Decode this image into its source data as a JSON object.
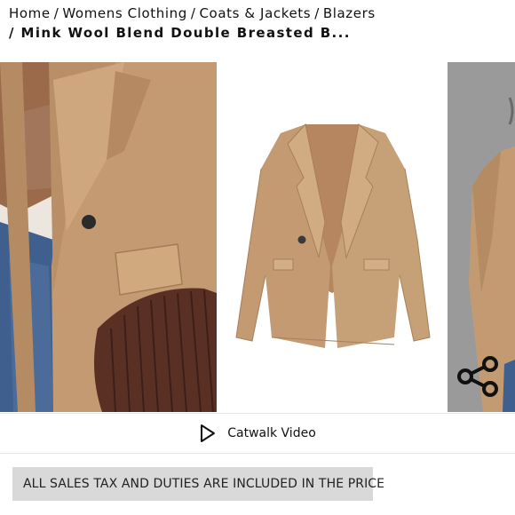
{
  "breadcrumb": {
    "items": [
      "Home",
      "Womens Clothing",
      "Coats & Jackets",
      "Blazers"
    ],
    "separator": "/",
    "current": "Mink Wool Blend Double Breasted B..."
  },
  "gallery": {
    "slides": [
      "model-closeup",
      "product-flatlay",
      "model-side"
    ]
  },
  "catwalk": {
    "label": "Catwalk Video",
    "icon": "play-icon"
  },
  "share": {
    "icon": "share-icon"
  },
  "tax_notice": {
    "text": "ALL SALES TAX AND DUTIES ARE INCLUDED IN THE PRICE"
  },
  "colors": {
    "coat": "#c39a72",
    "background": "#ffffff",
    "banner": "#d9d9d9"
  }
}
